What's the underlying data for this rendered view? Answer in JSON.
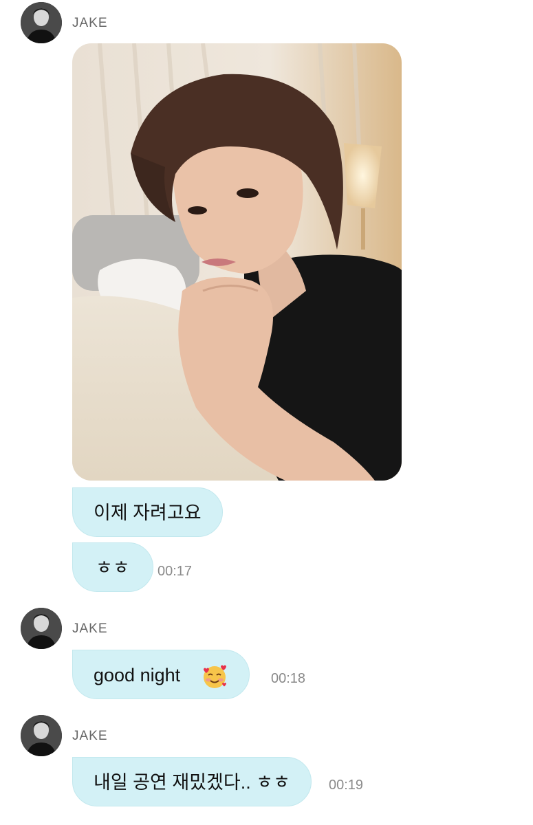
{
  "messages": [
    {
      "sender": "JAKE",
      "avatar_icon": "profile-photo"
    },
    {
      "photo_description": "selfie-photo"
    },
    {
      "text": "이제 자려고요"
    },
    {
      "text": "ㅎㅎ",
      "time": "00:17"
    },
    {
      "sender": "JAKE",
      "text": "good night",
      "emoji_icon": "smiling-face-with-hearts-icon",
      "time": "00:18"
    },
    {
      "sender": "JAKE",
      "text": "내일 공연 재밌겠다.. ㅎㅎ",
      "time": "00:19"
    }
  ],
  "colors": {
    "bubble": "#d3f1f6",
    "timestamp": "#8a8a8a",
    "sender": "#666666"
  }
}
